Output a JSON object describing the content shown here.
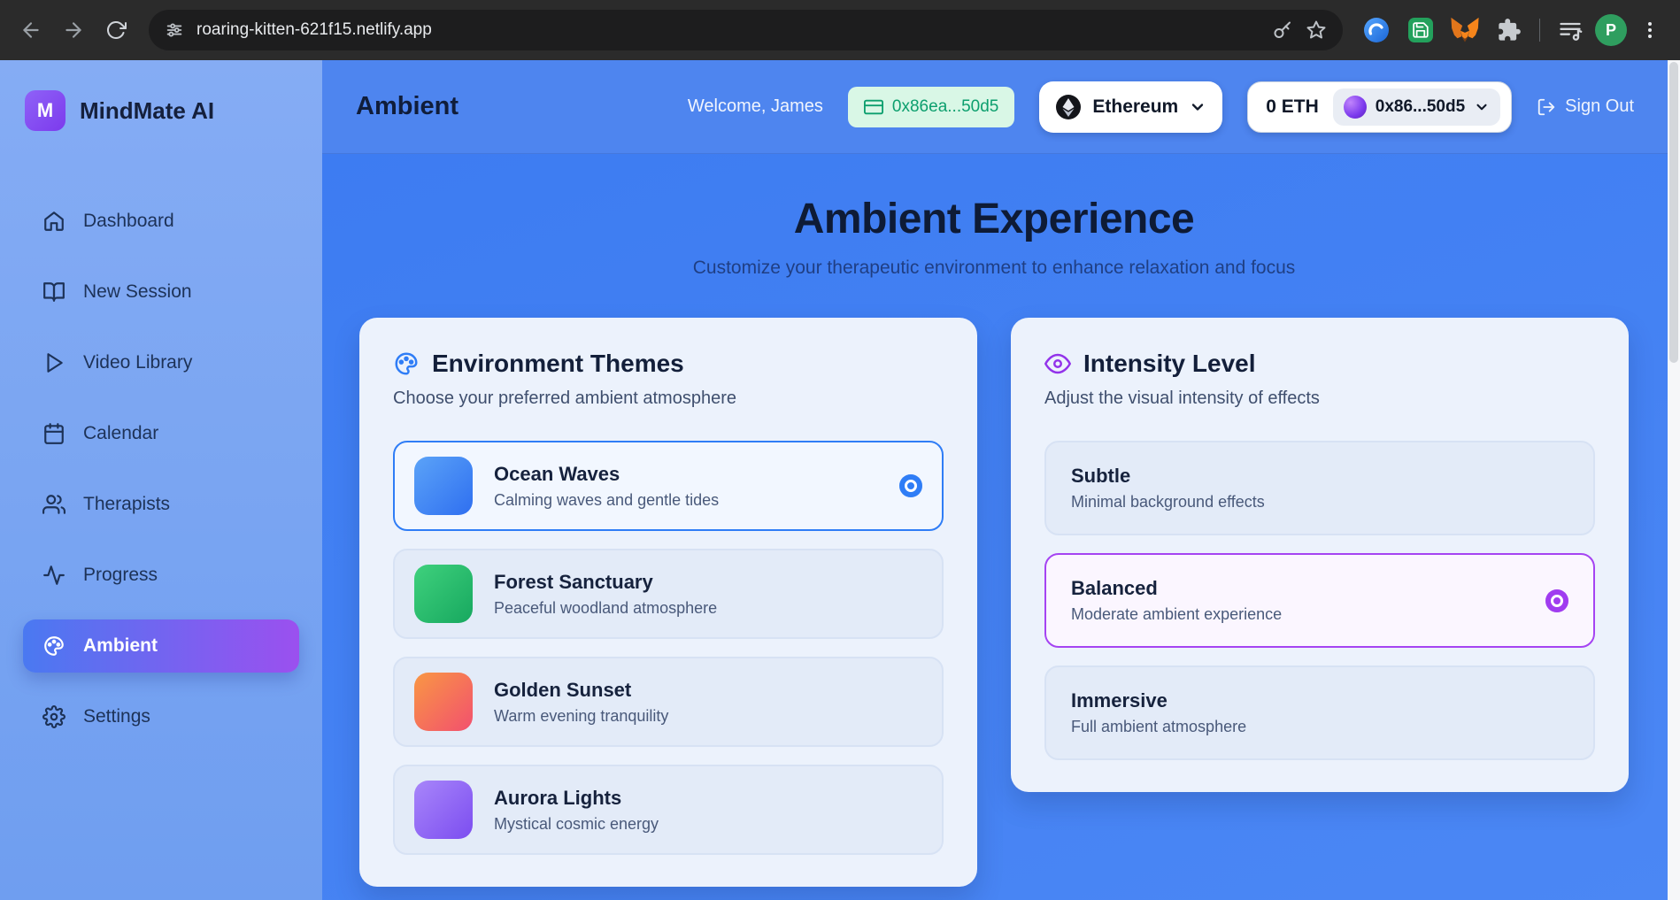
{
  "browser": {
    "url": "roaring-kitten-621f15.netlify.app",
    "profile_initial": "P"
  },
  "brand": {
    "logo_letter": "M",
    "name": "MindMate AI"
  },
  "sidebar": {
    "items": [
      {
        "label": "Dashboard",
        "icon": "home",
        "active": false
      },
      {
        "label": "New Session",
        "icon": "book-open",
        "active": false
      },
      {
        "label": "Video Library",
        "icon": "play",
        "active": false
      },
      {
        "label": "Calendar",
        "icon": "calendar",
        "active": false
      },
      {
        "label": "Therapists",
        "icon": "users",
        "active": false
      },
      {
        "label": "Progress",
        "icon": "activity",
        "active": false
      },
      {
        "label": "Ambient",
        "icon": "palette",
        "active": true
      },
      {
        "label": "Settings",
        "icon": "gear",
        "active": false
      }
    ]
  },
  "header": {
    "title": "Ambient",
    "welcome": "Welcome, James",
    "wallet_badge": "0x86ea...50d5",
    "network": "Ethereum",
    "balance": "0 ETH",
    "account": "0x86...50d5",
    "sign_out": "Sign Out"
  },
  "main": {
    "title": "Ambient Experience",
    "subtitle": "Customize your therapeutic environment to enhance relaxation and focus",
    "themes_card": {
      "title": "Environment Themes",
      "subtitle": "Choose your preferred ambient atmosphere",
      "options": [
        {
          "name": "Ocean Waves",
          "description": "Calming waves and gentle tides",
          "selected": true
        },
        {
          "name": "Forest Sanctuary",
          "description": "Peaceful woodland atmosphere",
          "selected": false
        },
        {
          "name": "Golden Sunset",
          "description": "Warm evening tranquility",
          "selected": false
        },
        {
          "name": "Aurora Lights",
          "description": "Mystical cosmic energy",
          "selected": false
        }
      ]
    },
    "intensity_card": {
      "title": "Intensity Level",
      "subtitle": "Adjust the visual intensity of effects",
      "options": [
        {
          "name": "Subtle",
          "description": "Minimal background effects",
          "selected": false
        },
        {
          "name": "Balanced",
          "description": "Moderate ambient experience",
          "selected": true
        },
        {
          "name": "Immersive",
          "description": "Full ambient atmosphere",
          "selected": false
        }
      ]
    }
  },
  "colors": {
    "accent_blue": "#2f7df6",
    "accent_purple": "#a03cf0",
    "wallet_badge_bg": "#d9f7e6",
    "wallet_badge_text": "#0c9f6e",
    "sidebar_bg": "#79a4f1",
    "topbar_bg": "#4e85ef",
    "main_bg": "#3e7df2",
    "card_bg": "#ecf2fc",
    "active_nav_gradient": [
      "#4a79f1",
      "#9b50ef"
    ]
  }
}
